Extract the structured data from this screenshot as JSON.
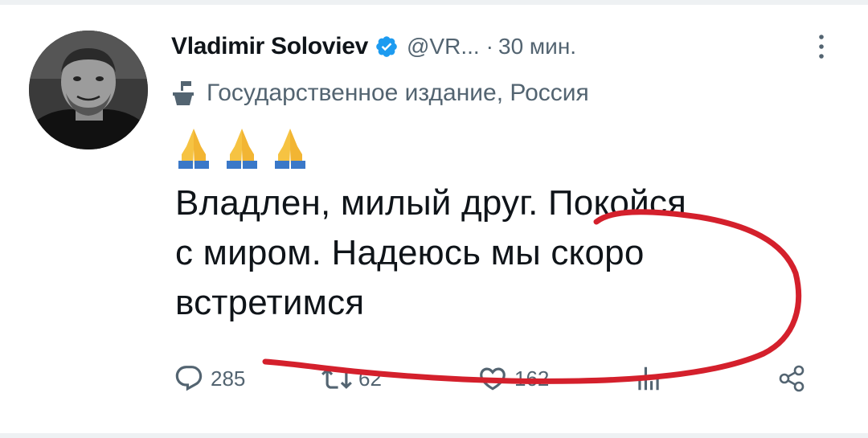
{
  "tweet": {
    "author_name": "Vladimir Soloviev",
    "handle": "@VR...",
    "separator": "·",
    "time": "30 мин.",
    "affiliation": "Государственное издание, Россия",
    "emojis": [
      "folded-hands",
      "folded-hands",
      "folded-hands"
    ],
    "text_lines": [
      "Владлен, милый друг. Покойся",
      "с миром. Надеюсь мы скоро",
      "встретимся"
    ],
    "actions": {
      "replies": "285",
      "retweets": "62",
      "likes": "162"
    }
  },
  "colors": {
    "text": "#0f1419",
    "secondary": "#536471",
    "verified": "#1d9bf0",
    "annotation_red": "#d4202c"
  },
  "icons": {
    "verified": "verified-badge-icon",
    "more": "more-vertical-icon",
    "affiliation": "government-building-icon",
    "reply": "reply-icon",
    "retweet": "retweet-icon",
    "like": "heart-icon",
    "views": "bar-chart-icon",
    "share": "share-icon"
  }
}
